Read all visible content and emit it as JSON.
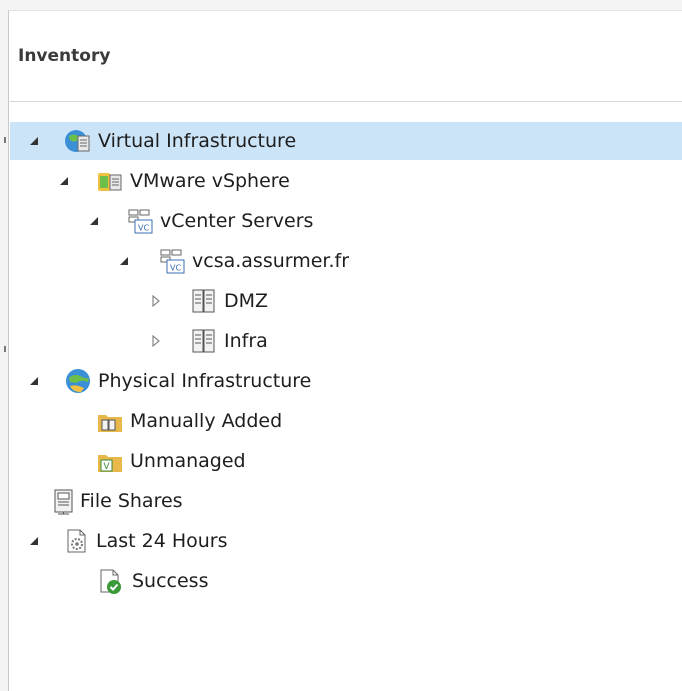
{
  "panel": {
    "title": "Inventory"
  },
  "tree": {
    "virtual_infrastructure": "Virtual Infrastructure",
    "vmware_vsphere": "VMware vSphere",
    "vcenter_servers": "vCenter Servers",
    "vcsa": "vcsa.assurmer.fr",
    "dmz": "DMZ",
    "infra": "Infra",
    "physical_infrastructure": "Physical Infrastructure",
    "manually_added": "Manually Added",
    "unmanaged": "Unmanaged",
    "file_shares": "File Shares",
    "last_24_hours": "Last 24 Hours",
    "success": "Success"
  },
  "colors": {
    "selection": "#cce4f7",
    "folder": "#e8b84a",
    "globe": "#3a8fd6"
  },
  "icons": {
    "virtual_infrastructure": "globe-server-icon",
    "vmware_vsphere": "vsphere-icon",
    "vcenter_servers": "vcenter-icon",
    "vcsa": "vcenter-server-icon",
    "dmz": "cluster-icon",
    "infra": "cluster-icon",
    "physical_infrastructure": "globe-icon",
    "manually_added": "folder-server-icon",
    "unmanaged": "folder-v-icon",
    "file_shares": "file-share-icon",
    "last_24_hours": "job-history-icon",
    "success": "success-icon"
  }
}
